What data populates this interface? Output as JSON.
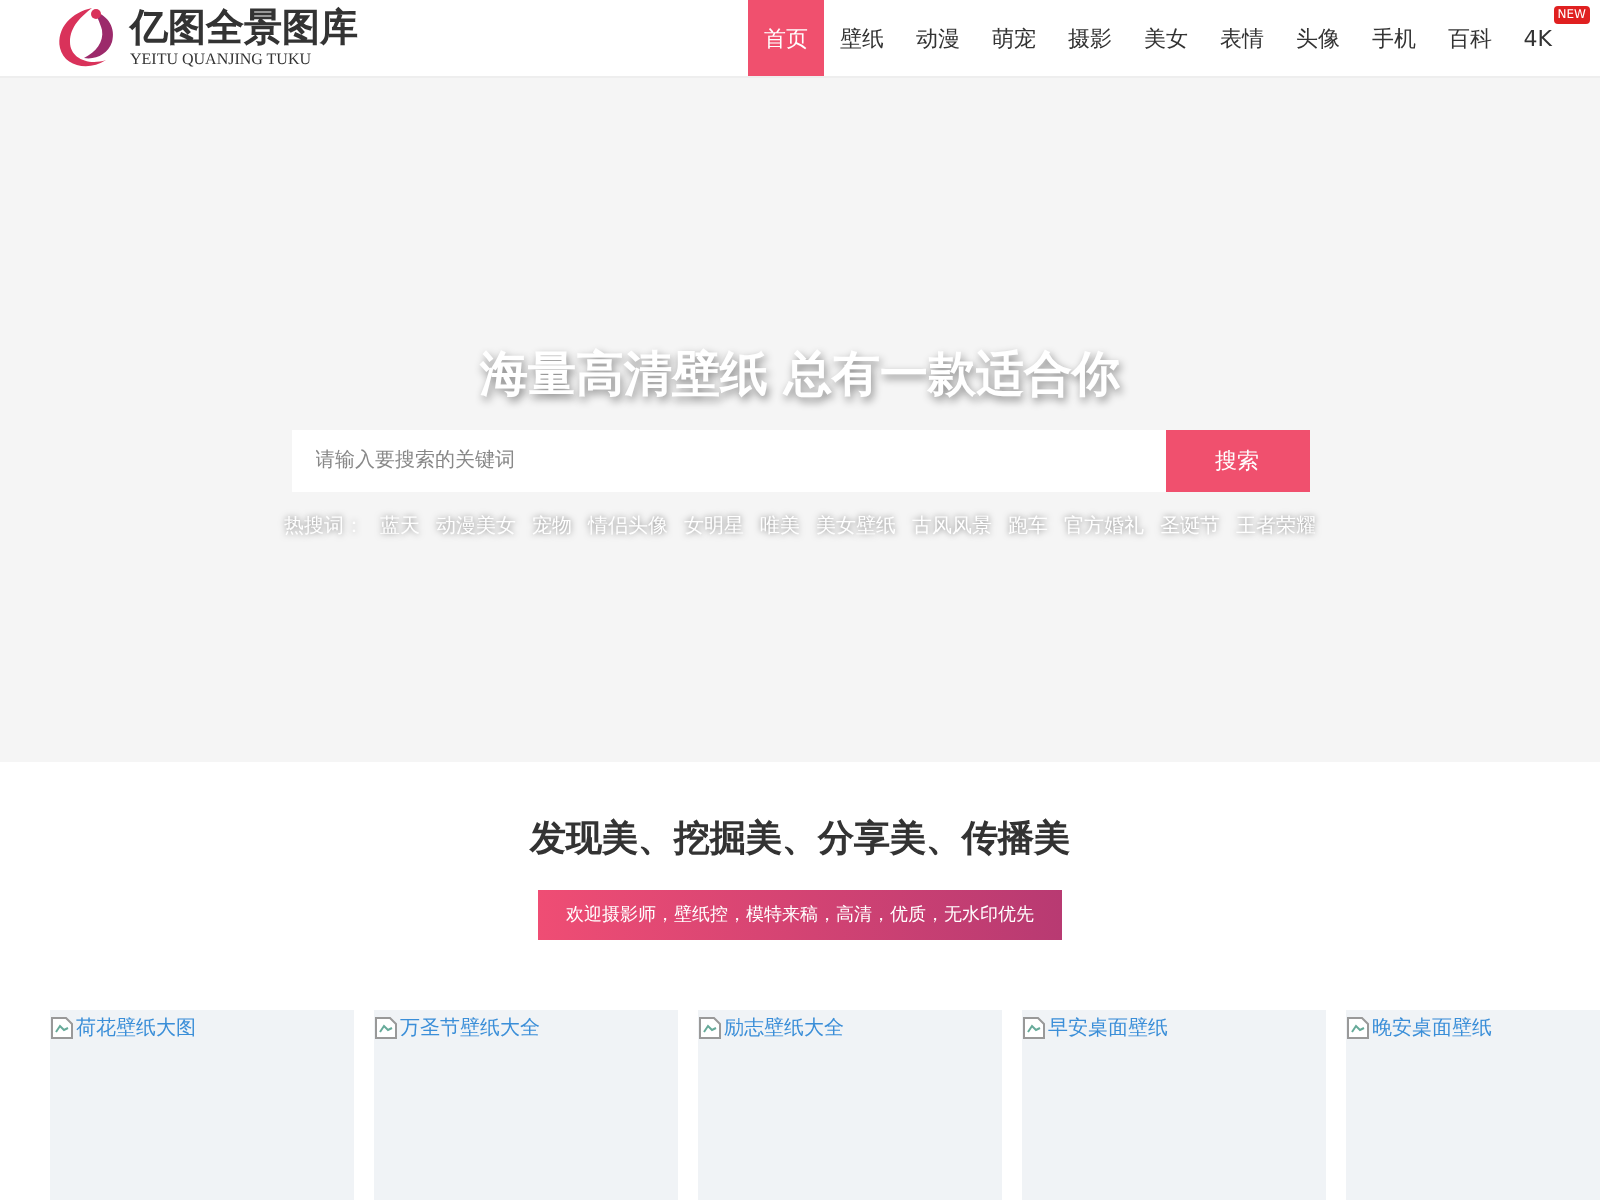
{
  "logo": {
    "title": "亿图全景图库",
    "subtitle": "YEITU QUANJING TUKU"
  },
  "nav": [
    {
      "label": "首页",
      "selected": true
    },
    {
      "label": "壁纸",
      "selected": false
    },
    {
      "label": "动漫",
      "selected": false
    },
    {
      "label": "萌宠",
      "selected": false
    },
    {
      "label": "摄影",
      "selected": false
    },
    {
      "label": "美女",
      "selected": false
    },
    {
      "label": "表情",
      "selected": false
    },
    {
      "label": "头像",
      "selected": false
    },
    {
      "label": "手机",
      "selected": false
    },
    {
      "label": "百科",
      "selected": false
    },
    {
      "label": "4K",
      "selected": false,
      "badge": "NEW"
    }
  ],
  "hero": {
    "title": "海量高清壁纸 总有一款适合你",
    "search": {
      "placeholder": "请输入要搜索的关键词",
      "button": "搜索"
    },
    "hot_label": "热搜词：",
    "hot_words": [
      "蓝天",
      "动漫美女",
      "宠物",
      "情侣头像",
      "女明星",
      "唯美",
      "美女壁纸",
      "古风风景",
      "跑车",
      "官方婚礼",
      "圣诞节",
      "王者荣耀"
    ]
  },
  "intro": {
    "heading": "发现美、挖掘美、分享美、传播美",
    "banner": "欢迎摄影师，壁纸控，模特来稿，高清，优质，无水印优先"
  },
  "cards": [
    {
      "alt": "荷花壁纸大图"
    },
    {
      "alt": "万圣节壁纸大全"
    },
    {
      "alt": "励志壁纸大全"
    },
    {
      "alt": "早安桌面壁纸"
    },
    {
      "alt": "晚安桌面壁纸"
    }
  ]
}
